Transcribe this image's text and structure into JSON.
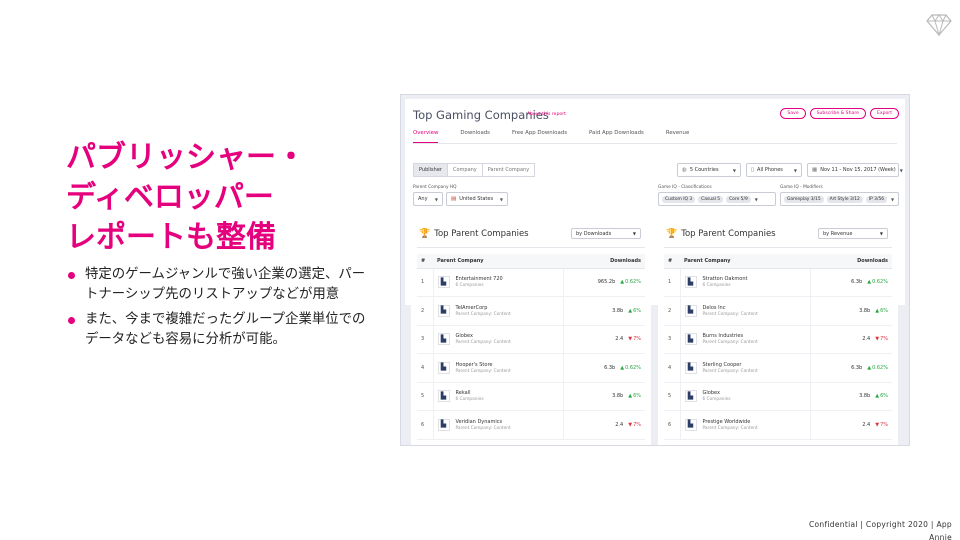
{
  "headline": [
    "パブリッシャー・",
    "ディベロッパー",
    "レポートも整備"
  ],
  "bullets": [
    "特定のゲームジャンルで強い企業の選定、パートナーシップ先のリストアップなどが用意",
    "また、今まで複雑だったグループ企業単位でのデータなども容易に分析が可能。"
  ],
  "footer": {
    "line1": "Confidential  |  Copyright 2020  |  App",
    "line2": "Annie"
  },
  "app": {
    "title": "Top Gaming Companies",
    "about_link": "About this report",
    "buttons": [
      "Save",
      "Subscribe & Share",
      "Export"
    ],
    "tabs": [
      "Overview",
      "Downloads",
      "Free App Downloads",
      "Paid App Downloads",
      "Revenue"
    ],
    "segment": [
      "Publisher",
      "Company",
      "Parent Company"
    ],
    "countries": "5 Countries",
    "devices": "All Phones",
    "date_range": "Nov 11 - Nov 15, 2017  (Week)",
    "hq_label": "Parent Company HQ",
    "hq_any": "Any",
    "hq_country": "United States",
    "classif_label": "Game IQ - Classifications",
    "classif_chips": [
      "Custom IQ 3",
      "Casual 5",
      "Core 5/9"
    ],
    "modifiers_label": "Game IQ - Modifiers",
    "modifier_chips": [
      "Gameplay 3/15",
      "Art Style 3/12",
      "IP 3/56"
    ]
  },
  "left_table": {
    "title": "Top Parent Companies",
    "sort": "by Downloads",
    "headers": [
      "#",
      "Parent Company",
      "Downloads"
    ],
    "rows": [
      {
        "idx": "1",
        "name": "Entertainment 720",
        "sub": "6 Companies",
        "value": "965.2b",
        "change": "0.62%",
        "dir": "up"
      },
      {
        "idx": "2",
        "name": "TelAmerCorp",
        "sub": "Parent Company: Content",
        "value": "3.8b",
        "change": "6%",
        "dir": "up"
      },
      {
        "idx": "3",
        "name": "Globex",
        "sub": "Parent Company: Content",
        "value": "2.4",
        "change": "7%",
        "dir": "down"
      },
      {
        "idx": "4",
        "name": "Hooper's Store",
        "sub": "Parent Company: Content",
        "value": "6.3b",
        "change": "0.62%",
        "dir": "up"
      },
      {
        "idx": "5",
        "name": "Rekall",
        "sub": "6 Companies",
        "value": "3.8b",
        "change": "6%",
        "dir": "up"
      },
      {
        "idx": "6",
        "name": "Veridian Dynamics",
        "sub": "Parent Company: Content",
        "value": "2.4",
        "change": "7%",
        "dir": "down"
      }
    ]
  },
  "right_table": {
    "title": "Top Parent Companies",
    "sort": "by Revenue",
    "headers": [
      "#",
      "Parent Company",
      "Downloads"
    ],
    "rows": [
      {
        "idx": "1",
        "name": "Stratton Oakmont",
        "sub": "6 Companies",
        "value": "6.3b",
        "change": "0.62%",
        "dir": "up"
      },
      {
        "idx": "2",
        "name": "Delos Inc",
        "sub": "Parent Company: Content",
        "value": "3.8b",
        "change": "6%",
        "dir": "up"
      },
      {
        "idx": "3",
        "name": "Burns Industries",
        "sub": "Parent Company: Content",
        "value": "2.4",
        "change": "7%",
        "dir": "down"
      },
      {
        "idx": "4",
        "name": "Sterling Cooper",
        "sub": "Parent Company: Content",
        "value": "6.3b",
        "change": "0.62%",
        "dir": "up"
      },
      {
        "idx": "5",
        "name": "Globex",
        "sub": "6 Companies",
        "value": "3.8b",
        "change": "6%",
        "dir": "up"
      },
      {
        "idx": "6",
        "name": "Prestige Worldwide",
        "sub": "Parent Company: Content",
        "value": "2.4",
        "change": "7%",
        "dir": "down"
      }
    ]
  },
  "colors": {
    "accent": "#e5007d",
    "up": "#27a842",
    "down": "#e0323f",
    "panel_bg": "#eceef3"
  },
  "icons": {
    "logo": "diamond-icon",
    "trophy": "trophy-icon",
    "company": "building-icon",
    "globe": "globe-icon",
    "phone": "phone-icon",
    "calendar": "calendar-icon",
    "flag": "us-flag-icon"
  }
}
